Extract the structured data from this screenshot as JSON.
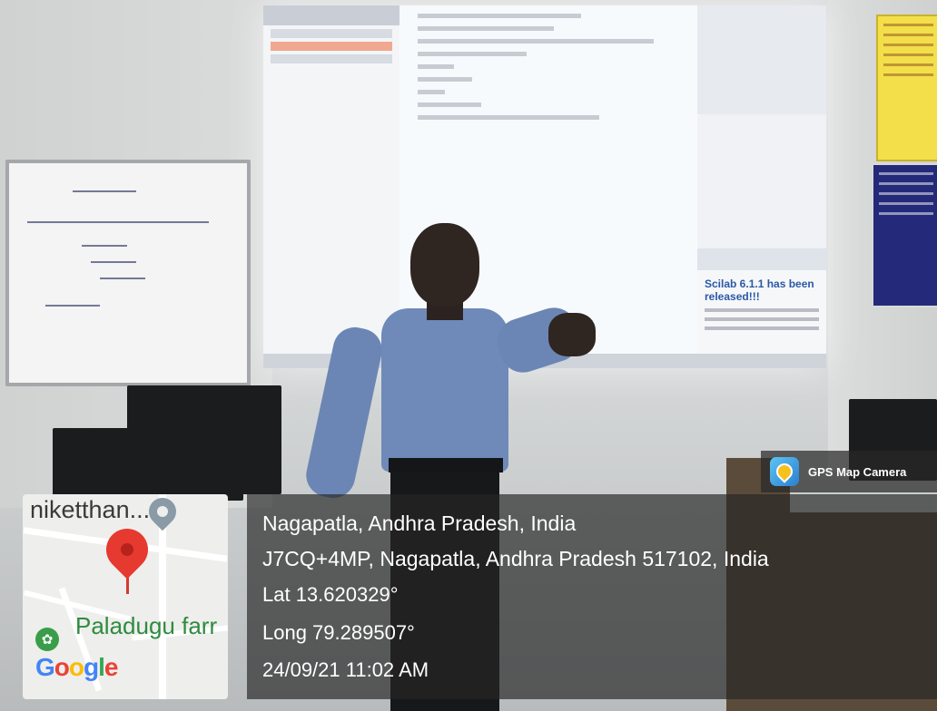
{
  "overlay": {
    "app_label": "GPS Map Camera",
    "place": "Nagapatla, Andhra Pradesh, India",
    "address": "J7CQ+4MP, Nagapatla, Andhra Pradesh 517102, India",
    "latitude": "Lat 13.620329°",
    "longitude": "Long 79.289507°",
    "datetime": "24/09/21 11:02 AM"
  },
  "map": {
    "poi_top": "niketthan...",
    "poi_farm": "Paladugu farr",
    "brand_letters": [
      "G",
      "o",
      "o",
      "g",
      "l",
      "e"
    ]
  },
  "projection": {
    "news_headline": "Scilab 6.1.1 has been released!!!"
  }
}
